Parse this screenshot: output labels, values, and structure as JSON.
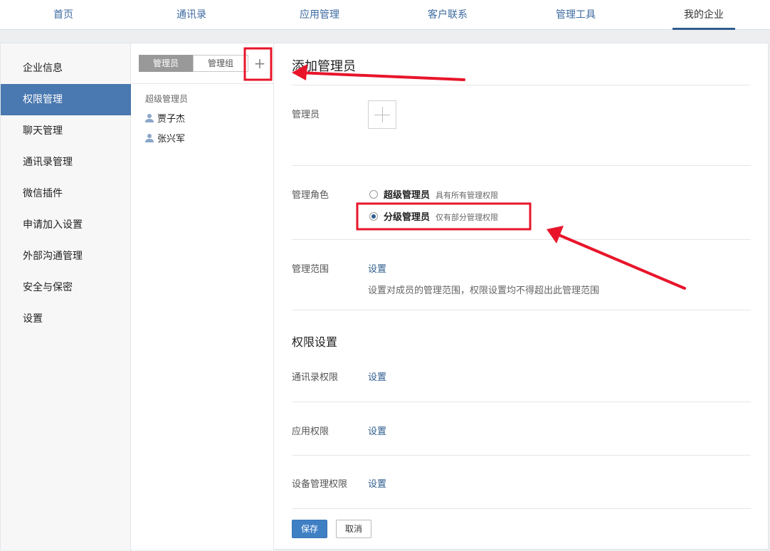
{
  "topnav": {
    "tabs": [
      {
        "label": "首页"
      },
      {
        "label": "通讯录"
      },
      {
        "label": "应用管理"
      },
      {
        "label": "客户联系"
      },
      {
        "label": "管理工具"
      },
      {
        "label": "我的企业"
      }
    ],
    "active_index": 5
  },
  "sidebar": {
    "items": [
      {
        "label": "企业信息"
      },
      {
        "label": "权限管理"
      },
      {
        "label": "聊天管理"
      },
      {
        "label": "通讯录管理"
      },
      {
        "label": "微信插件"
      },
      {
        "label": "申请加入设置"
      },
      {
        "label": "外部沟通管理"
      },
      {
        "label": "安全与保密"
      },
      {
        "label": "设置"
      }
    ],
    "active_index": 1
  },
  "midcol": {
    "seg_admin": "管理员",
    "seg_group": "管理组",
    "add_symbol": "+",
    "group_title": "超级管理员",
    "members": [
      "贾子杰",
      "张兴军"
    ]
  },
  "content": {
    "title": "添加管理员",
    "admin_label": "管理员",
    "role_label": "管理角色",
    "role_super": "超级管理员",
    "role_super_desc": "具有所有管理权限",
    "role_sub": "分级管理员",
    "role_sub_desc": "仅有部分管理权限",
    "role_selected": "分级管理员",
    "scope_label": "管理范围",
    "scope_link": "设置",
    "scope_hint": "设置对成员的管理范围，权限设置均不得超出此管理范围",
    "perm_title": "权限设置",
    "perm_contacts_label": "通讯录权限",
    "perm_contacts_link": "设置",
    "perm_app_label": "应用权限",
    "perm_app_link": "设置",
    "perm_device_label": "设备管理权限",
    "perm_device_link": "设置",
    "save_button": "保存",
    "cancel_button": "取消"
  },
  "colors": {
    "accent": "#4a78b0",
    "link": "#2f5d8e",
    "annotation_red": "#e8152a",
    "save_button": "#3f7fc4"
  },
  "icons": {
    "member": "user-icon",
    "add": "plus-icon"
  }
}
